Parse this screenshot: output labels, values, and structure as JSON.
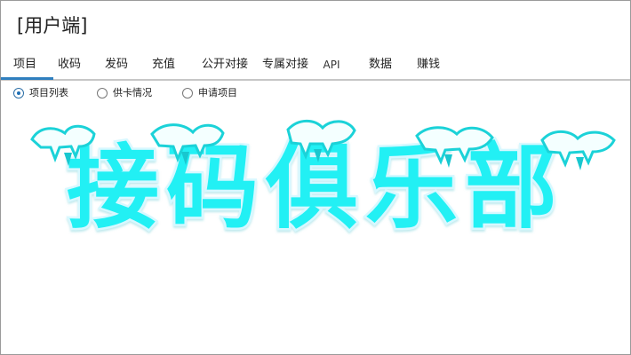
{
  "title": "[用户端]",
  "tabs": [
    {
      "label": "项目",
      "active": true
    },
    {
      "label": "收码",
      "active": false
    },
    {
      "label": "发码",
      "active": false
    },
    {
      "label": "充值",
      "active": false
    },
    {
      "label": "公开对接",
      "active": false
    },
    {
      "label": "专属对接",
      "active": false
    },
    {
      "label": "API",
      "active": false
    },
    {
      "label": "数据",
      "active": false
    },
    {
      "label": "赚钱",
      "active": false
    }
  ],
  "radios": [
    {
      "label": "项目列表",
      "selected": true
    },
    {
      "label": "供卡情况",
      "selected": false
    },
    {
      "label": "申请项目",
      "selected": false
    }
  ],
  "banner": {
    "text": "接码俱乐部",
    "fill_color": "#21f0f4",
    "outline_color": "#d7f8ff",
    "snow_color": "#f4ffff",
    "drip_color": "#19c7cf"
  },
  "theme": {
    "accent": "#2f7fbf",
    "separator": "#c6c6c6"
  }
}
